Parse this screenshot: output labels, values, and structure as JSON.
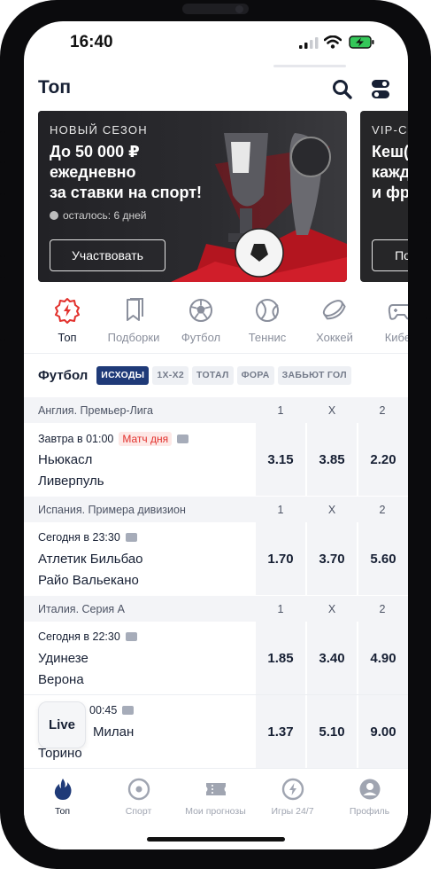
{
  "status": {
    "time": "16:40"
  },
  "page": {
    "title": "Топ"
  },
  "banners": [
    {
      "tag": "НОВЫЙ СЕЗОН",
      "headline": "До 50 000 ₽\nежедневно\nза ставки на спорт!",
      "timer": "осталось: 6 дней",
      "button": "Участвовать"
    },
    {
      "tag": "VIP-С",
      "headline": "Кеш(\nкажд\nи фр",
      "button": "По"
    }
  ],
  "categories": [
    {
      "label": "Топ",
      "icon": "lightning-icon",
      "active": true
    },
    {
      "label": "Подборки",
      "icon": "bookmark-icon"
    },
    {
      "label": "Футбол",
      "icon": "soccer-ball-icon"
    },
    {
      "label": "Теннис",
      "icon": "tennis-ball-icon"
    },
    {
      "label": "Хоккей",
      "icon": "hockey-puck-icon"
    },
    {
      "label": "Кибер",
      "icon": "gamepad-icon"
    }
  ],
  "filters": {
    "sport": "Футбол",
    "chips": [
      "ИСХОДЫ",
      "1Х-Х2",
      "ТОТАЛ",
      "ФОРА",
      "ЗАБЬЮТ ГОЛ"
    ],
    "active_chip": "ИСХОДЫ"
  },
  "outcome_headers": [
    "1",
    "X",
    "2"
  ],
  "leagues": [
    {
      "name": "Англия. Премьер-Лига",
      "match": {
        "when": "Завтра в 01:00",
        "badge": "Матч дня",
        "home": "Ньюкасл",
        "away": "Ливерпуль",
        "odds": [
          "3.15",
          "3.85",
          "2.20"
        ]
      }
    },
    {
      "name": "Испания. Примера дивизион",
      "match": {
        "when": "Сегодня в 23:30",
        "home": "Атлетик Бильбао",
        "away": "Райо Вальекано",
        "odds": [
          "1.70",
          "3.70",
          "5.60"
        ]
      }
    },
    {
      "name": "Италия. Серия А",
      "match": {
        "when": "Сегодня в 22:30",
        "home": "Удинезе",
        "away": "Верона",
        "odds": [
          "1.85",
          "3.40",
          "4.90"
        ]
      }
    },
    {
      "name": "",
      "match": {
        "when": "00:45",
        "home": "Милан",
        "away": "Торино",
        "odds": [
          "1.37",
          "5.10",
          "9.00"
        ]
      }
    }
  ],
  "live_button": "Live",
  "tabbar": [
    {
      "label": "Топ",
      "icon": "flame-icon",
      "active": true
    },
    {
      "label": "Спорт",
      "icon": "sport-target-icon"
    },
    {
      "label": "Мои прогнозы",
      "icon": "ticket-icon"
    },
    {
      "label": "Игры 24/7",
      "icon": "lightning-circle-icon"
    },
    {
      "label": "Профиль",
      "icon": "profile-icon"
    }
  ],
  "colors": {
    "accent": "#1f3a78",
    "live_red": "#e2302c",
    "text": "#172034",
    "muted": "#8a8f9c"
  }
}
